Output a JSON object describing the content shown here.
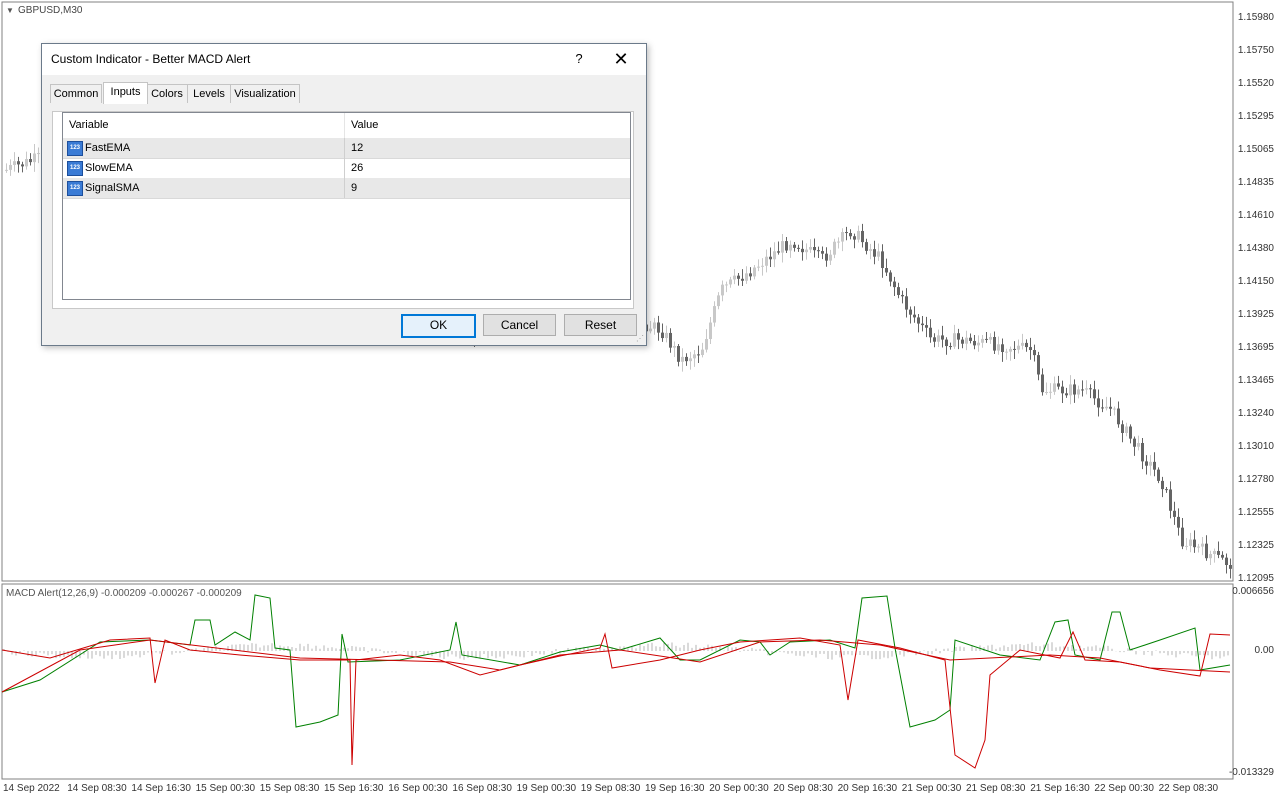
{
  "chart": {
    "symbol": "GBPUSD,M30",
    "price_scale": [
      "1.15980",
      "1.15750",
      "1.15520",
      "1.15295",
      "1.15065",
      "1.14835",
      "1.14610",
      "1.14380",
      "1.14150",
      "1.13925",
      "1.13695",
      "1.13465",
      "1.13240",
      "1.13010",
      "1.12780",
      "1.12555",
      "1.12325",
      "1.12095"
    ],
    "time_axis": [
      "14 Sep 2022",
      "14 Sep 08:30",
      "14 Sep 16:30",
      "15 Sep 00:30",
      "15 Sep 08:30",
      "15 Sep 16:30",
      "16 Sep 00:30",
      "16 Sep 08:30",
      "19 Sep 00:30",
      "19 Sep 08:30",
      "19 Sep 16:30",
      "20 Sep 00:30",
      "20 Sep 08:30",
      "20 Sep 16:30",
      "21 Sep 00:30",
      "21 Sep 08:30",
      "21 Sep 16:30",
      "22 Sep 00:30",
      "22 Sep 08:30"
    ],
    "macd": {
      "label": "MACD Alert(12,26,9) -0.000209 -0.000267 -0.000209",
      "scale": [
        "0.006656",
        "0.00",
        "-0.013329"
      ]
    },
    "colors": {
      "bull_candle": "#c8c8c8",
      "bear_candle": "#646464",
      "macd_line": "#008000",
      "signal_line": "#cc0000",
      "histogram": "#b4b4b4"
    }
  },
  "dialog": {
    "title": "Custom Indicator - Better MACD Alert",
    "help": "?",
    "close": "✕",
    "tabs": [
      "Common",
      "Inputs",
      "Colors",
      "Levels",
      "Visualization"
    ],
    "active_tab": "Inputs",
    "table": {
      "headers": [
        "Variable",
        "Value"
      ],
      "rows": [
        {
          "variable": "FastEMA",
          "value": "12"
        },
        {
          "variable": "SlowEMA",
          "value": "26"
        },
        {
          "variable": "SignalSMA",
          "value": "9"
        }
      ],
      "icon_text": "123"
    },
    "buttons": {
      "ok": "OK",
      "cancel": "Cancel",
      "reset": "Reset"
    }
  }
}
